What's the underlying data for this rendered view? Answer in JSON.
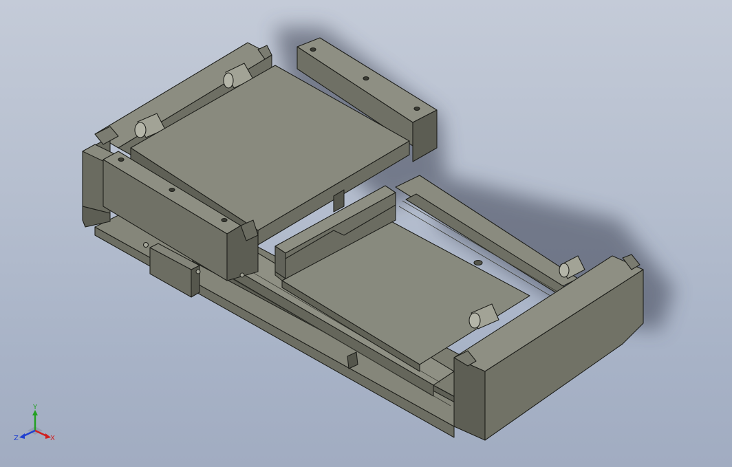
{
  "viewer": {
    "background_top": "#c4cbd8",
    "background_bottom": "#a1acc1",
    "part_face_top": "#8b8c80",
    "part_face_front": "#6f7065",
    "part_face_side": "#5c5d53",
    "edge_color": "#1e1f1b"
  },
  "triad": {
    "x_label": "X",
    "y_label": "Y",
    "z_label": "Z",
    "x_color": "#d02020",
    "y_color": "#22a022",
    "z_color": "#2040d0"
  }
}
